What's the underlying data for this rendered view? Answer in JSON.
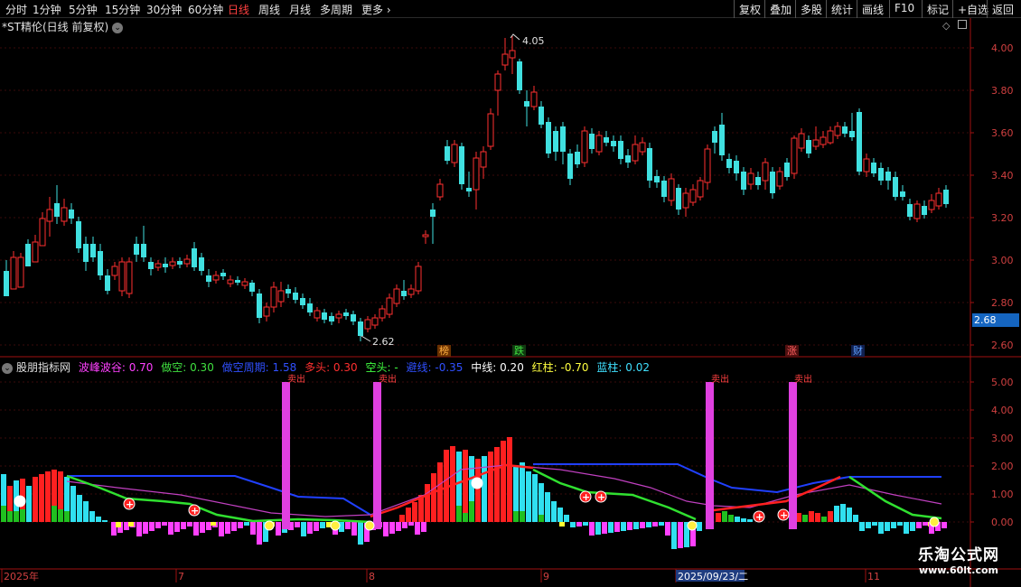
{
  "toolbar": {
    "periods": [
      "分时",
      "1分钟",
      "5分钟",
      "15分钟",
      "30分钟",
      "60分钟",
      "日线",
      "周线",
      "月线",
      "多周期",
      "更多"
    ],
    "active_period": "日线",
    "right_buttons": [
      "复权",
      "叠加",
      "多股",
      "统计",
      "画线",
      "F10",
      "标记",
      "+自选",
      "返回"
    ]
  },
  "stock_title": "*ST精伦(日线 前复权)",
  "price_axis": [
    "4.00",
    "3.80",
    "3.60",
    "3.40",
    "3.20",
    "3.00",
    "2.80",
    "2.60"
  ],
  "current_price": "2.68",
  "high_marker": "4.05",
  "low_marker": "2.62",
  "event_badges": [
    {
      "text": "榜",
      "color": "#d08020"
    },
    {
      "text": "跌",
      "color": "#20c040"
    },
    {
      "text": "涨",
      "color": "#e03030"
    },
    {
      "text": "财",
      "color": "#3080e0"
    }
  ],
  "indicator": {
    "name": "股朋指标网",
    "params": [
      {
        "label": "波峰波谷: 0.70",
        "color": "#ff40ff"
      },
      {
        "label": "做空: 0.30",
        "color": "#40e040"
      },
      {
        "label": "做空周期: 1.58",
        "color": "#2040ff"
      },
      {
        "label": "多头: 0.30",
        "color": "#ff3030"
      },
      {
        "label": "空头: -",
        "color": "#40ff40"
      },
      {
        "label": "避线: -0.35",
        "color": "#2040ff"
      },
      {
        "label": "中线: 0.20",
        "color": "#ffffff"
      },
      {
        "label": "红柱: -0.70",
        "color": "#ffff40"
      },
      {
        "label": "蓝柱: 0.02",
        "color": "#40e0ff"
      }
    ]
  },
  "indicator_axis": [
    "5.00",
    "4.00",
    "3.00",
    "2.00",
    "1.00",
    "0.00"
  ],
  "date_axis": [
    "2025年",
    "7",
    "8",
    "9",
    "2025/09/23/二",
    "11"
  ],
  "peak_labels": [
    "卖出",
    "卖出",
    "卖出",
    "卖出"
  ],
  "logo": {
    "line1": "乐淘公式网",
    "line2": "www.60lt.com"
  },
  "colors": {
    "up": "#ff3030",
    "down": "#40e0e0",
    "axis": "#a01010",
    "grid": "#3a0a0a"
  }
}
